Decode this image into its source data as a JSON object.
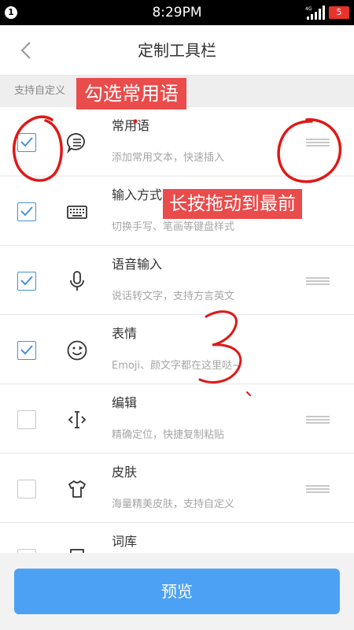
{
  "status_bar": {
    "notification_count": "1",
    "time": "8:29PM",
    "network": "4G",
    "battery": "5"
  },
  "header": {
    "back_icon": "chevron-left-icon",
    "title": "定制工具栏"
  },
  "subheader": {
    "text": "支持自定义"
  },
  "annotations": {
    "select_phrases": "勾选常用语",
    "long_press_drag": "长按拖动到最前",
    "handwritten_number": "3"
  },
  "items": [
    {
      "title": "常用语",
      "description": "添加常用文本，快速插入",
      "checked": true,
      "icon": "chat-bubble-icon"
    },
    {
      "title": "输入方式",
      "description": "切换手写、笔画等键盘样式",
      "checked": true,
      "icon": "keyboard-icon"
    },
    {
      "title": "语音输入",
      "description": "说话转文字，支持方言英文",
      "checked": true,
      "icon": "microphone-icon"
    },
    {
      "title": "表情",
      "description": "Emoji、颜文字都在这里哒~",
      "checked": true,
      "icon": "emoji-face-icon"
    },
    {
      "title": "编辑",
      "description": "精确定位，快捷复制粘贴",
      "checked": false,
      "icon": "text-cursor-icon"
    },
    {
      "title": "皮肤",
      "description": "海量精美皮肤，支持自定义",
      "checked": false,
      "icon": "tshirt-icon"
    },
    {
      "title": "词库",
      "description": "",
      "checked": false,
      "icon": "dictionary-icon"
    }
  ],
  "colors": {
    "accent_blue": "#4da1f5",
    "checkbox_blue": "#4a90d9",
    "annotation_red": "#ea4b4b",
    "ink_red": "#e01818"
  },
  "footer": {
    "preview_label": "预览"
  }
}
